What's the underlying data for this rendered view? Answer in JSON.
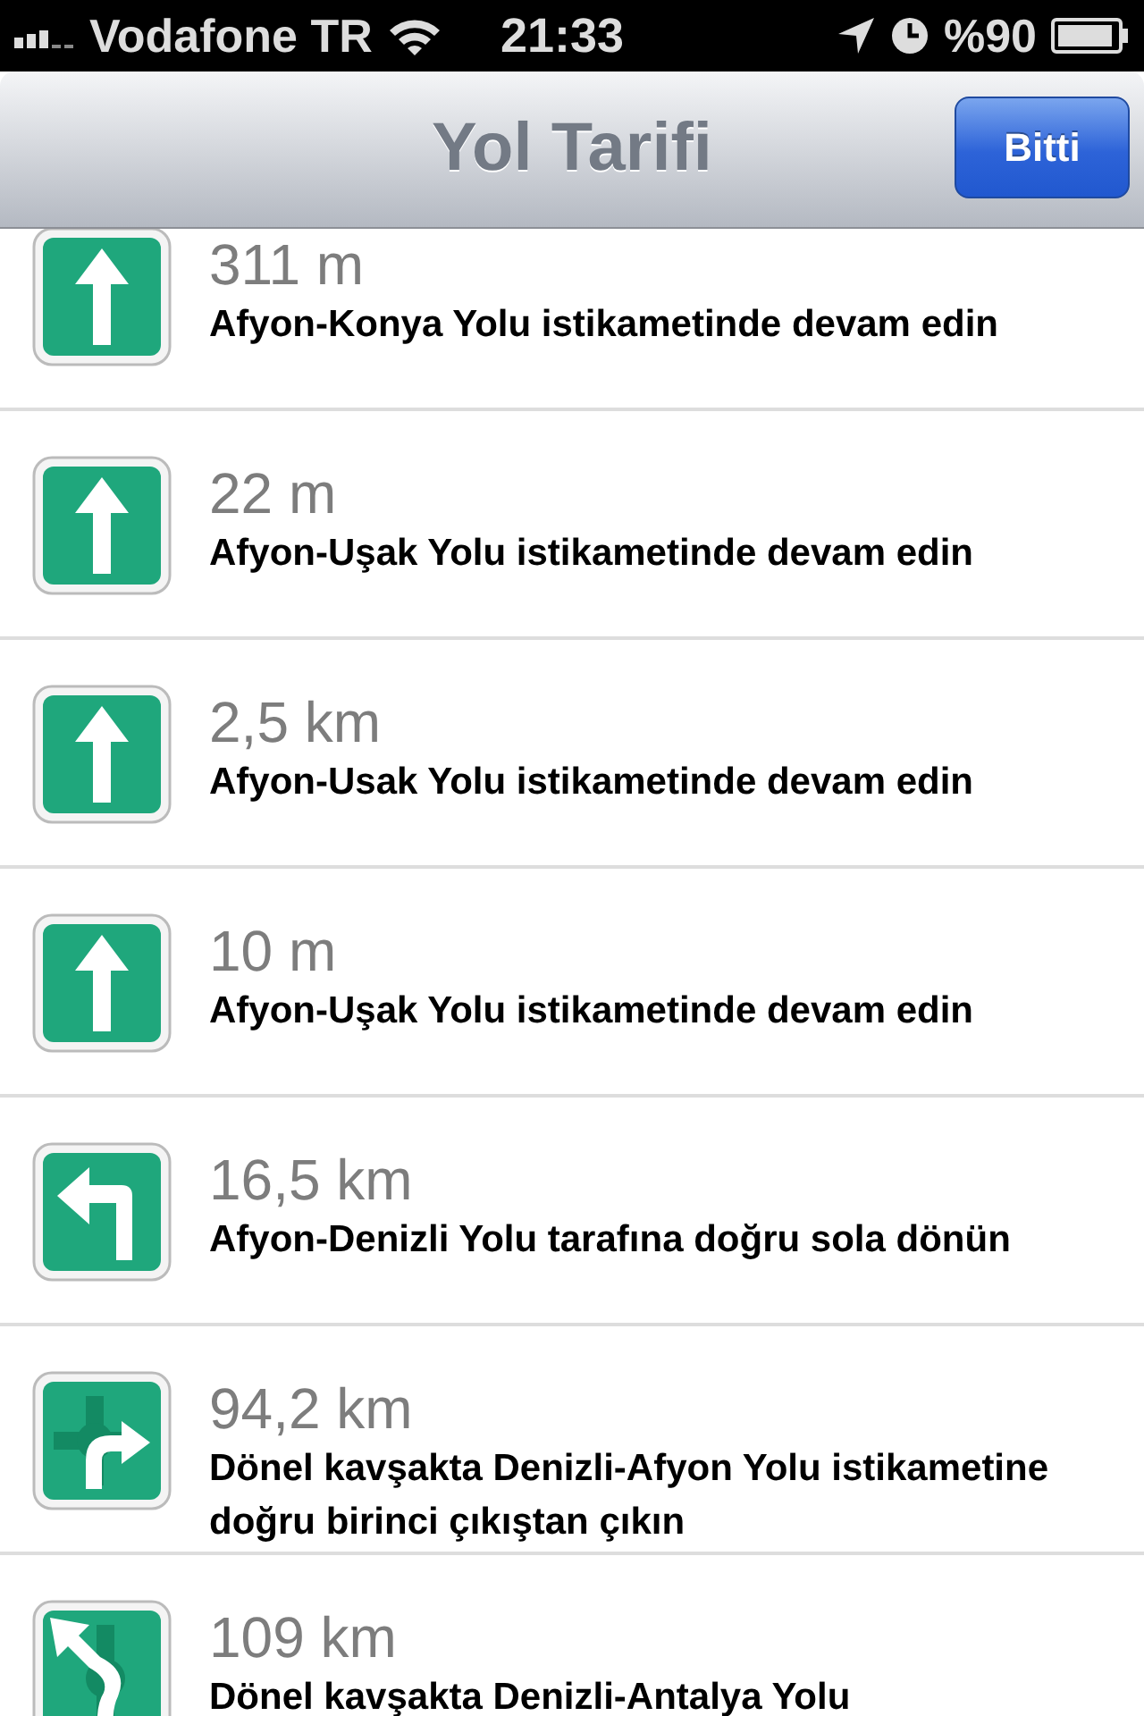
{
  "status_bar": {
    "carrier": "Vodafone TR",
    "time": "21:33",
    "battery": "%90"
  },
  "nav_bar": {
    "title": "Yol Tarifi",
    "done_button": "Bitti"
  },
  "steps": [
    {
      "kind": "straight",
      "distance": "311 m",
      "instruction": "Afyon-Konya Yolu istikametinde devam edin"
    },
    {
      "kind": "straight",
      "distance": "22 m",
      "instruction": "Afyon-Uşak Yolu istikametinde devam edin"
    },
    {
      "kind": "straight",
      "distance": "2,5 km",
      "instruction": "Afyon-Usak Yolu istikametinde devam edin"
    },
    {
      "kind": "straight",
      "distance": "10 m",
      "instruction": "Afyon-Uşak Yolu istikametinde devam edin"
    },
    {
      "kind": "left",
      "distance": "16,5 km",
      "instruction": "Afyon-Denizli Yolu tarafına doğru sola dönün"
    },
    {
      "kind": "roundabout_right",
      "distance": "94,2 km",
      "instruction": "Dönel kavşakta Denizli-Afyon Yolu istikametine doğru birinci çıkıştan çıkın"
    },
    {
      "kind": "roundabout_left",
      "distance": "109 km",
      "instruction": "Dönel kavşakta Denizli-Antalya Yolu"
    }
  ]
}
